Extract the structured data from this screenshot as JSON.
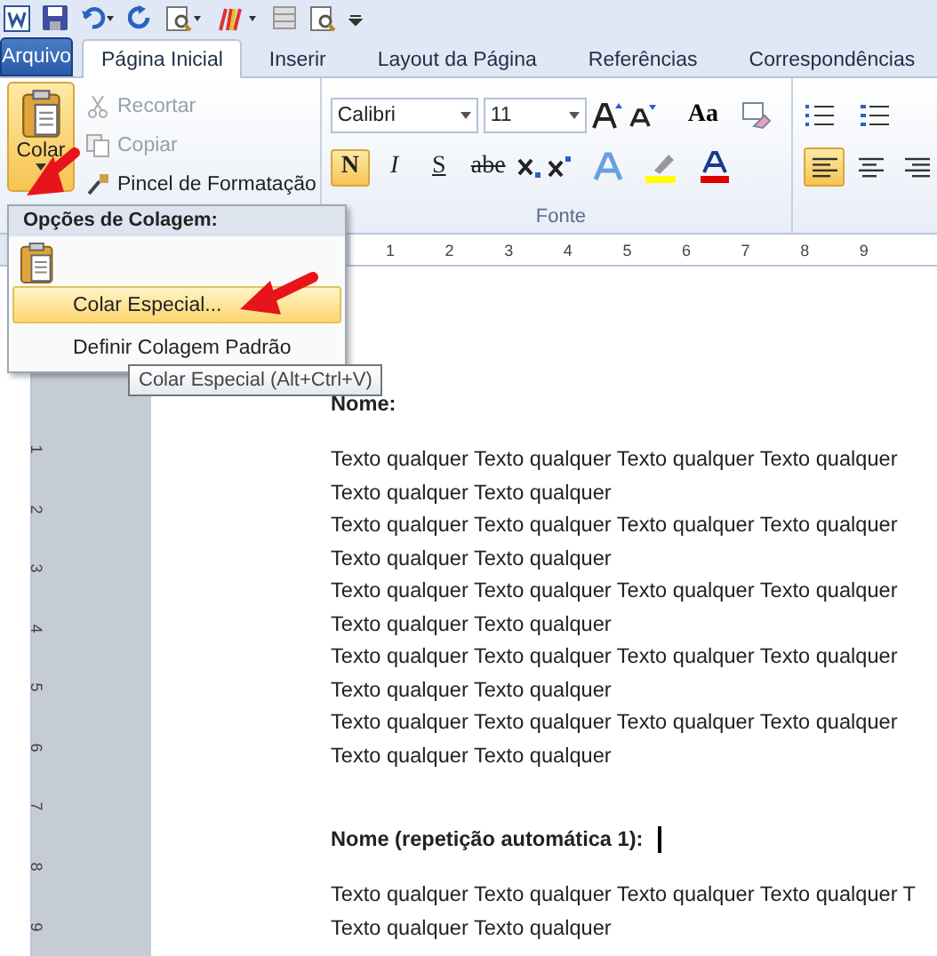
{
  "tabs": [
    {
      "label": "Arquivo",
      "kind": "file",
      "selected": false
    },
    {
      "label": "Página Inicial",
      "kind": "tab",
      "selected": true
    },
    {
      "label": "Inserir",
      "kind": "tab",
      "selected": false
    },
    {
      "label": "Layout da Página",
      "kind": "tab",
      "selected": false
    },
    {
      "label": "Referências",
      "kind": "tab",
      "selected": false
    },
    {
      "label": "Correspondências",
      "kind": "tab",
      "selected": false
    }
  ],
  "clipboard": {
    "paste_label": "Colar",
    "items": [
      {
        "label": "Recortar",
        "kind": "cut",
        "disabled": true
      },
      {
        "label": "Copiar",
        "kind": "copy",
        "disabled": true
      },
      {
        "label": "Pincel de Formatação",
        "kind": "brush",
        "disabled": false
      }
    ]
  },
  "font_group": {
    "font": "Calibri",
    "size": "11",
    "label": "Fonte",
    "case_button": "Aa",
    "format_buttons": [
      {
        "label": "N",
        "kind": "bold",
        "selected": true
      },
      {
        "label": "I",
        "kind": "italic",
        "selected": false
      },
      {
        "label": "S",
        "kind": "underline",
        "selected": false
      },
      {
        "label": "abe",
        "kind": "strike",
        "selected": false
      }
    ]
  },
  "paragraph_group": {
    "alignments": [
      {
        "kind": "left",
        "selected": true
      },
      {
        "kind": "center",
        "selected": false
      },
      {
        "kind": "right",
        "selected": false
      }
    ]
  },
  "ruler": {
    "horizontal": [
      "1",
      "2",
      "3",
      "4",
      "5",
      "6",
      "7",
      "8",
      "9"
    ],
    "vertical": [
      "1",
      "2",
      "3",
      "4",
      "5",
      "6",
      "7",
      "8",
      "9"
    ]
  },
  "paste_menu": {
    "header": "Opções de Colagem:",
    "items": [
      {
        "label": "Colar Especial...",
        "selected": true
      },
      {
        "label": "Definir Colagem Padrão",
        "selected": false
      }
    ],
    "tooltip": "Colar Especial (Alt+Ctrl+V)"
  },
  "document": {
    "blocks": [
      {
        "kind": "heading",
        "text": "Nome:"
      },
      {
        "kind": "body",
        "lines": [
          "Texto qualquer Texto qualquer Texto qualquer Texto qualquer",
          "Texto qualquer Texto qualquer",
          "Texto qualquer Texto qualquer Texto qualquer Texto qualquer",
          "Texto qualquer Texto qualquer",
          "Texto qualquer Texto qualquer Texto qualquer Texto qualquer",
          "Texto qualquer Texto qualquer",
          "Texto qualquer Texto qualquer Texto qualquer Texto qualquer",
          "Texto qualquer Texto qualquer",
          "Texto qualquer Texto qualquer Texto qualquer Texto qualquer",
          "Texto qualquer Texto qualquer"
        ]
      },
      {
        "kind": "heading",
        "text": "Nome (repetição automática 1):",
        "cursor": true
      },
      {
        "kind": "body",
        "lines": [
          "Texto qualquer Texto qualquer Texto qualquer Texto qualquer T",
          "Texto qualquer Texto qualquer"
        ]
      }
    ]
  }
}
